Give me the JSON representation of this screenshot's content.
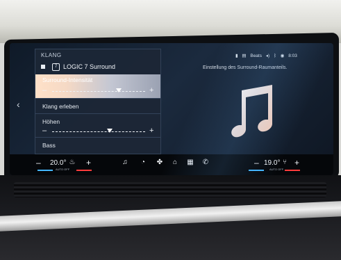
{
  "panel": {
    "title": "KLANG",
    "preset": "LOGIC 7 Surround",
    "surround_label": "Surround-Intensität",
    "surround_level": 0.72,
    "klang_erleben": "Klang erleben",
    "hoehen_label": "Höhen",
    "hoehen_level": 0.62,
    "bass_label": "Bass"
  },
  "caption": "Einstellung des Surround-Raumanteils.",
  "status": {
    "brand": "Beats",
    "time": "8:03"
  },
  "climate": {
    "left_temp": "20.0°",
    "right_temp": "19.0°",
    "auto_off": "AUTO OFF",
    "minus": "–",
    "plus": "+"
  },
  "icons": [
    "chevron-left-icon",
    "music-note-icon",
    "seat-heat-icon",
    "media-icon",
    "phone-icon",
    "fan-icon",
    "home-icon",
    "apps-icon",
    "call-icon",
    "seat-icon"
  ],
  "colors": {
    "accent_blue": "#43b6ff",
    "accent_red": "#ff3b3b",
    "highlight": "#ffe1c8"
  }
}
